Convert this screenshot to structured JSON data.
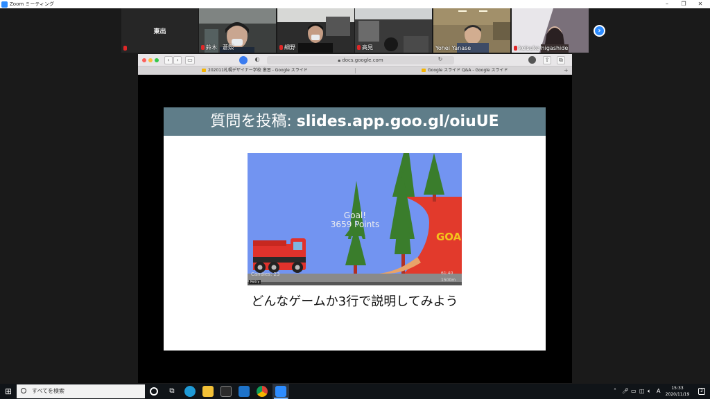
{
  "window": {
    "title": "Zoom ミーティング",
    "minimize_label": "–",
    "restore_label": "❐",
    "close_label": "✕"
  },
  "participants": [
    {
      "name": "東出",
      "video": false
    },
    {
      "name": "鈴木　蒼熙",
      "video": true
    },
    {
      "name": "細野",
      "video": true
    },
    {
      "name": "高見",
      "video": true
    },
    {
      "name": "Yohei Yanase",
      "video": true
    },
    {
      "name": "keisuke higashide",
      "video": true
    }
  ],
  "next_page_icon": "chevron-right-icon",
  "browser": {
    "url": "docs.google.com",
    "tabs": [
      {
        "label": "202011札幌デザイナー学校 激習 - Google スライド"
      },
      {
        "label": "Google スライド Q&A - Google スライド"
      }
    ],
    "new_tab_label": "+"
  },
  "slide": {
    "header_prefix": "質問を投稿: ",
    "header_link": "slides.app.goo.gl/oiuUE",
    "game": {
      "goal_line1": "Goal!",
      "goal_line2": "3659 Points",
      "goal_sign": "GOA",
      "hud_left": "Candies: 23",
      "hud_right_top": "61:40",
      "hud_right_bottom": "1500m",
      "badge": "Retry"
    },
    "caption": "どんなゲームか3行で説明してみよう"
  },
  "taskbar": {
    "search_placeholder": "すべてを検索",
    "time": "15:33",
    "date": "2020/11/19",
    "ime": "A",
    "notifications": "2"
  },
  "colors": {
    "zoom_blue": "#2d8cff",
    "slide_header": "#5f7d89",
    "game_sky": "#7294f1",
    "truck_red": "#e0322c",
    "tree_green": "#3a7d2c"
  }
}
